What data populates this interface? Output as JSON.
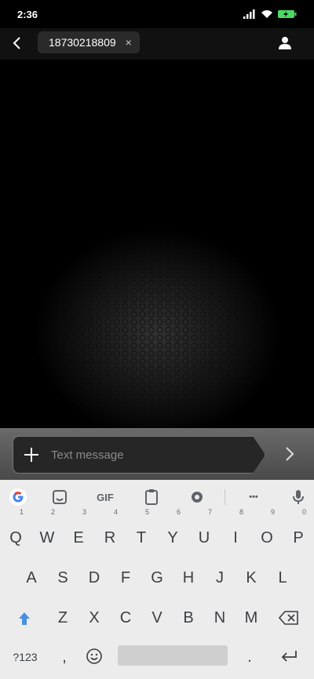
{
  "status": {
    "time": "2:36"
  },
  "header": {
    "recipient": "18730218809",
    "chip_close": "×"
  },
  "compose": {
    "placeholder": "Text message"
  },
  "keyboard": {
    "toolbar": {
      "gif": "GIF",
      "more": "•••"
    },
    "row1": [
      {
        "k": "Q",
        "h": "1"
      },
      {
        "k": "W",
        "h": "2"
      },
      {
        "k": "E",
        "h": "3"
      },
      {
        "k": "R",
        "h": "4"
      },
      {
        "k": "T",
        "h": "5"
      },
      {
        "k": "Y",
        "h": "6"
      },
      {
        "k": "U",
        "h": "7"
      },
      {
        "k": "I",
        "h": "8"
      },
      {
        "k": "O",
        "h": "9"
      },
      {
        "k": "P",
        "h": "0"
      }
    ],
    "row2": [
      "A",
      "S",
      "D",
      "F",
      "G",
      "H",
      "J",
      "K",
      "L"
    ],
    "row3": [
      "Z",
      "X",
      "C",
      "V",
      "B",
      "N",
      "M"
    ],
    "row4": {
      "symbols": "?123",
      "comma": ",",
      "period": "."
    }
  }
}
